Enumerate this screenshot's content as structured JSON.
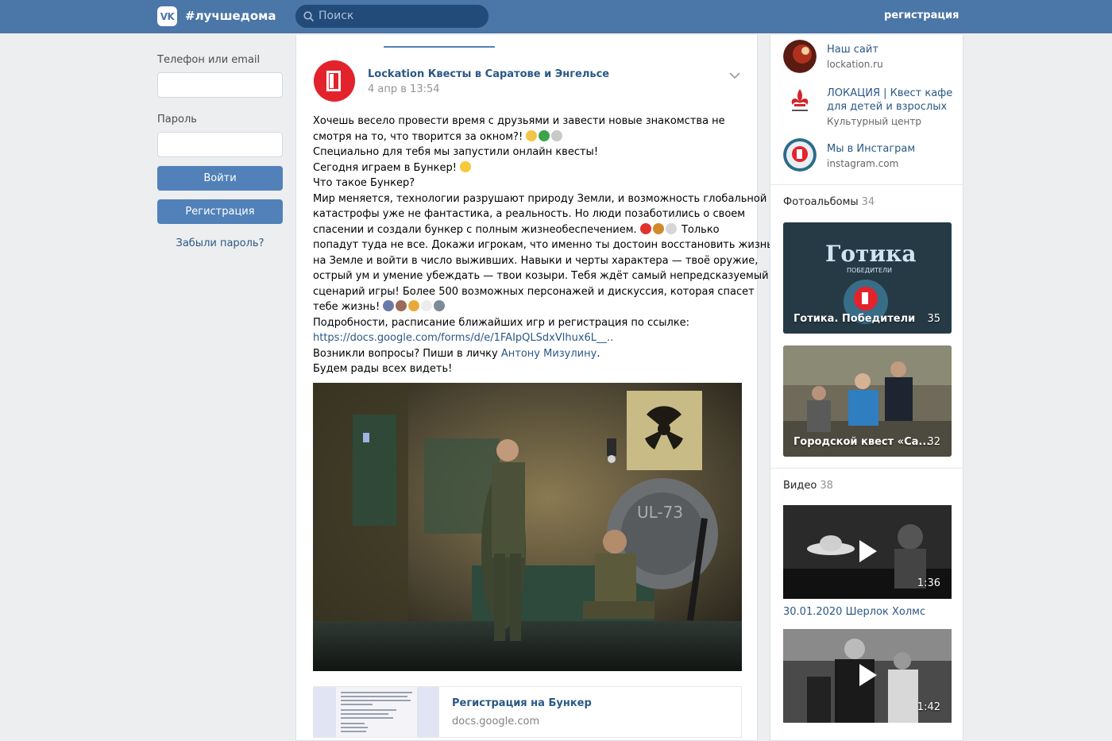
{
  "header": {
    "logo_text": "VK",
    "hashtag": "#лучшедома",
    "search_placeholder": "Поиск",
    "register_link": "регистрация"
  },
  "login": {
    "phone_label": "Телефон или email",
    "password_label": "Пароль",
    "login_button": "Войти",
    "register_button": "Регистрация",
    "forgot_link": "Забыли пароль?"
  },
  "post": {
    "author": "Lockation Квесты в Саратове и Энгельсе",
    "date": "4 апр в 13:54",
    "lines": [
      "Хочешь весело провести время с друзьями и завести новые знакомства не",
      "смотря на то, что творится за окном?!",
      "Специально для тебя мы запустили онлайн квесты!",
      "Сегодня играем в Бункер!",
      "Что такое Бункер?",
      "Мир меняется, технологии разрушают природу Земли, и возможность глобальной",
      "катастрофы уже не фантастика, а реальность. Но люди позаботились о своем",
      "спасении и создали бункер с полным жизнеобеспечением.",
      "Только",
      "попадут туда не все. Докажи игрокам, что именно ты достоин восстановить жизнь",
      "на Земле и войти в число выживших. Навыки и черты характера — твоё оружие,",
      "острый ум и умение убеждать — твои козыри. Тебя ждёт самый непредсказуемый",
      "сценарий игры! Более 500 возможных персонажей и дискуссия, которая спасет",
      "тебе жизнь!",
      "Подробности, расписание ближайших игр и регистрация по ссылке:",
      "https://docs.google.com/forms/d/e/1FAIpQLSdxVlhux6L__..",
      "Возникли вопросы? Пиши в личку",
      "Антону Мизулину",
      ".",
      "Будем рады всех видеть!"
    ],
    "photo_sign": "UL-73",
    "link_card": {
      "title": "Регистрация на Бункер",
      "domain": "docs.google.com"
    }
  },
  "sidebar": {
    "links": [
      {
        "title": "Наш сайт",
        "subtitle": "lockation.ru"
      },
      {
        "title_line1": "ЛОКАЦИЯ | Квест кафе",
        "title_line2": "для детей и взрослых",
        "subtitle": "Культурный центр"
      },
      {
        "title": "Мы в Инстаграм",
        "subtitle": "instagram.com"
      }
    ],
    "albums_title": "Фотоальбомы",
    "albums_count": "34",
    "albums": [
      {
        "name": "Готика. Победители",
        "count": "35",
        "banner": "Готика",
        "banner_sub": "ПОБЕДИТЕЛИ"
      },
      {
        "name": "Городской квест «Са...",
        "count": "32"
      }
    ],
    "videos_title": "Видео",
    "videos_count": "38",
    "videos": [
      {
        "duration": "1:36",
        "title": "30.01.2020 Шерлок Холмс"
      },
      {
        "duration": "1:42"
      }
    ]
  },
  "colors": {
    "header_bg": "#4a76a8",
    "accent": "#5181b8",
    "link": "#2a5885",
    "page_bg": "#edeef0",
    "brand_red": "#e3232c"
  }
}
